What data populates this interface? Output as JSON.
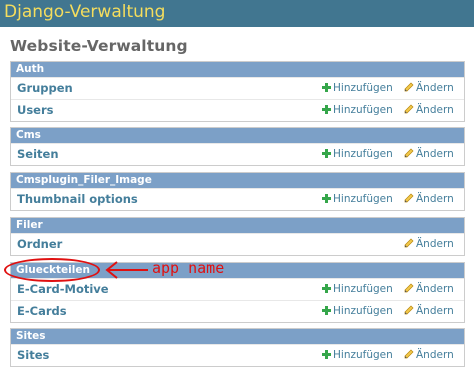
{
  "header": {
    "branding": "Django-Verwaltung"
  },
  "page": {
    "title": "Website-Verwaltung"
  },
  "modules": [
    {
      "caption": "Auth",
      "rows": [
        {
          "name": "Gruppen",
          "add": "Hinzufügen",
          "change": "Ändern"
        },
        {
          "name": "Users",
          "add": "Hinzufügen",
          "change": "Ändern"
        }
      ]
    },
    {
      "caption": "Cms",
      "rows": [
        {
          "name": "Seiten",
          "add": "Hinzufügen",
          "change": "Ändern"
        }
      ]
    },
    {
      "caption": "Cmsplugin_Filer_Image",
      "rows": [
        {
          "name": "Thumbnail options",
          "add": "Hinzufügen",
          "change": "Ändern"
        }
      ]
    },
    {
      "caption": "Filer",
      "rows": [
        {
          "name": "Ordner",
          "change": "Ändern"
        }
      ]
    },
    {
      "caption": "Glueckteilen",
      "rows": [
        {
          "name": "E-Card-Motive",
          "add": "Hinzufügen",
          "change": "Ändern"
        },
        {
          "name": "E-Cards",
          "add": "Hinzufügen",
          "change": "Ändern"
        }
      ]
    },
    {
      "caption": "Sites",
      "rows": [
        {
          "name": "Sites",
          "add": "Hinzufügen",
          "change": "Ändern"
        }
      ]
    }
  ],
  "annotation": {
    "text": "app name",
    "color": "#e01010"
  },
  "colors": {
    "header_bg": "#417690",
    "branding": "#f5dd5d",
    "caption_bg": "#7ca0c7",
    "link": "#447e9b",
    "add_icon": "#35a64a"
  },
  "icons": {
    "add": "green-plus-icon",
    "change": "pencil-icon"
  }
}
